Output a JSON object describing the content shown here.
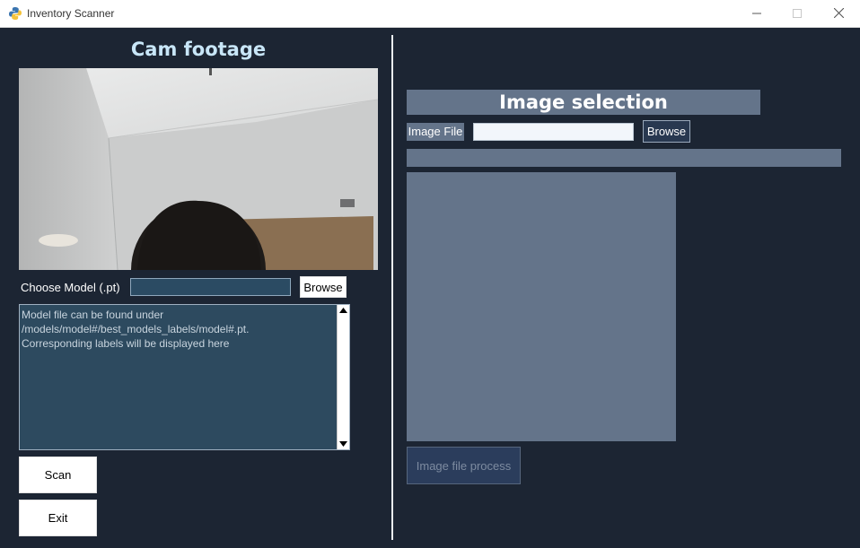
{
  "window": {
    "title": "Inventory Scanner",
    "app_icon": "python-icon",
    "controls": {
      "minimize": "minimize-icon",
      "maximize": "maximize-icon",
      "close": "close-icon"
    }
  },
  "left": {
    "cam_title": "Cam footage",
    "model_label": "Choose Model (.pt)",
    "model_value": "",
    "browse_label": "Browse",
    "info_text": "Model file can be found under\n/models/model#/best_models_labels/model#.pt.\nCorresponding labels will be displayed here",
    "scan_label": "Scan",
    "exit_label": "Exit"
  },
  "right": {
    "title": "Image selection",
    "image_file_label": "Image File",
    "image_file_value": "",
    "browse_label": "Browse",
    "status_text": "",
    "process_label": "Image file process"
  },
  "colors": {
    "background": "#1c2533",
    "panel": "#64748a",
    "cam_title": "#c8e6f8",
    "textarea_bg": "#2d4a5f"
  }
}
